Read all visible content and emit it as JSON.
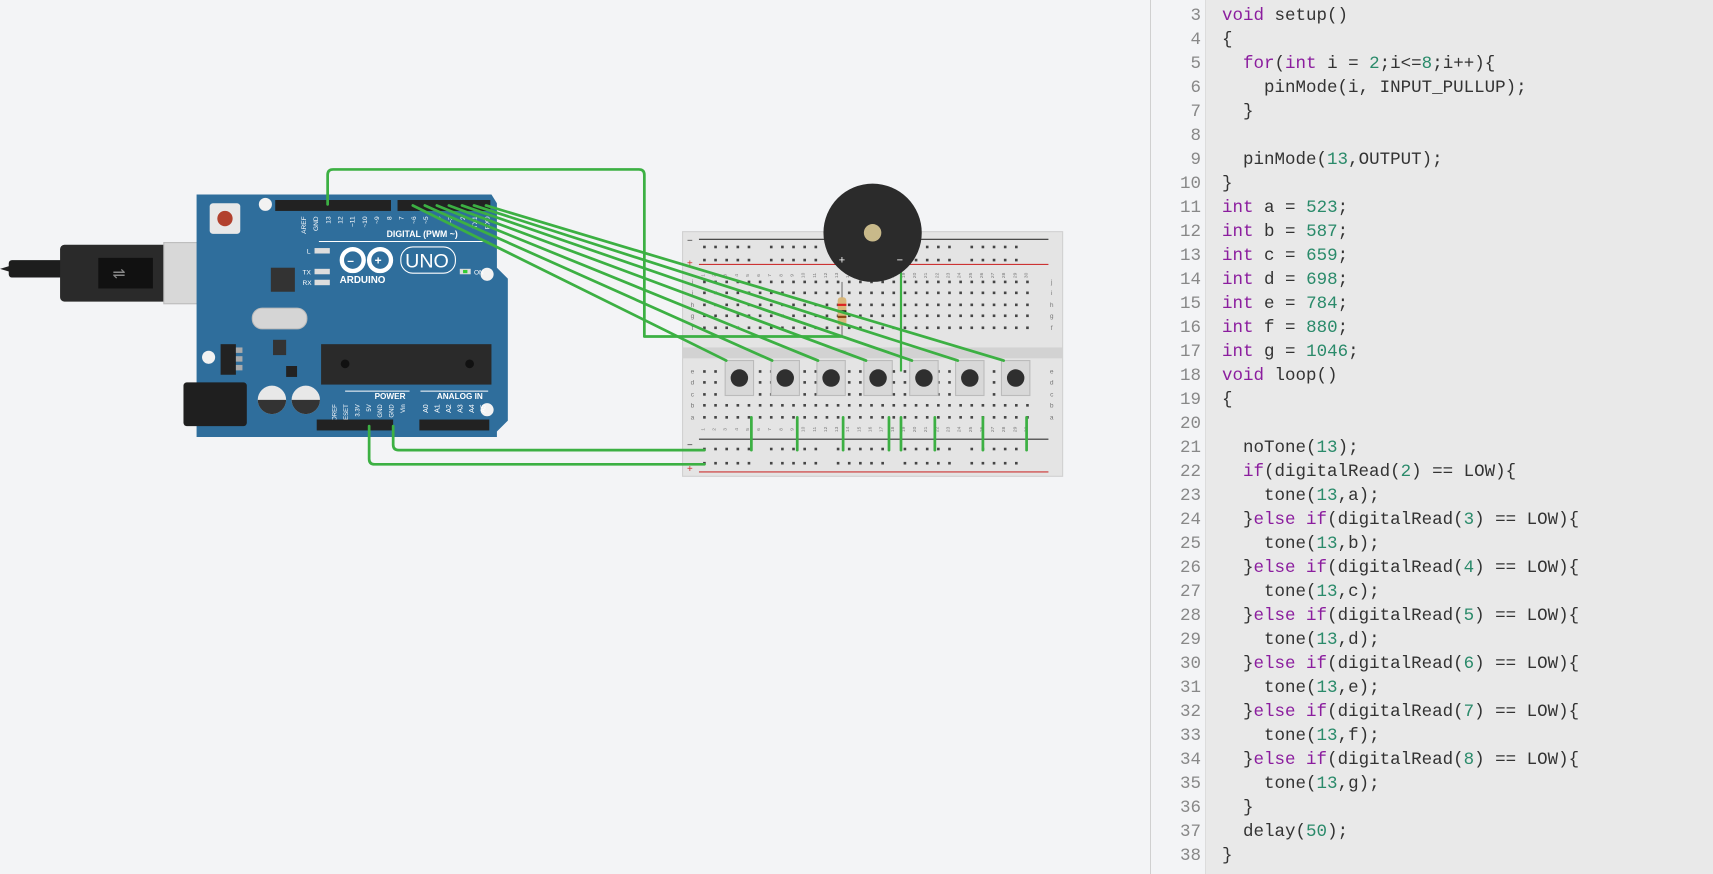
{
  "circuit": {
    "arduino": {
      "brand": "ARDUINO",
      "model": "UNO",
      "digital_label": "DIGITAL (PWM ~)",
      "power_label": "POWER",
      "analog_label": "ANALOG IN",
      "on_label": "ON",
      "led_labels": [
        "L",
        "TX",
        "RX"
      ],
      "digital_pins": [
        "AREF",
        "GND",
        "13",
        "12",
        "~11",
        "~10",
        "~9",
        "8",
        "7",
        "~6",
        "~5",
        "4",
        "~3",
        "2",
        "TX1",
        "RX0"
      ],
      "power_pins": [
        "IOREF",
        "RESET",
        "3.3V",
        "5V",
        "GND",
        "GND",
        "Vin"
      ],
      "analog_pins": [
        "A0",
        "A1",
        "A2",
        "A3",
        "A4",
        "A5"
      ],
      "board_color": "#2f6e9c"
    },
    "wire_color": "#3cb043",
    "buttons_count": 7,
    "breadboard_columns": 30,
    "breadboard_rows_top": [
      "j",
      "i",
      "h",
      "g",
      "f"
    ],
    "breadboard_rows_bottom": [
      "e",
      "d",
      "c",
      "b",
      "a"
    ],
    "rail_minus": "−",
    "rail_plus": "+"
  },
  "code": {
    "lines": [
      {
        "n": "3",
        "text": "void setup()"
      },
      {
        "n": "4",
        "text": "{"
      },
      {
        "n": "5",
        "text": "  for(int i = 2;i<=8;i++){"
      },
      {
        "n": "6",
        "text": "    pinMode(i, INPUT_PULLUP);"
      },
      {
        "n": "7",
        "text": "  }"
      },
      {
        "n": "8",
        "text": ""
      },
      {
        "n": "9",
        "text": "  pinMode(13,OUTPUT);"
      },
      {
        "n": "10",
        "text": "}"
      },
      {
        "n": "11",
        "text": "int a = 523;"
      },
      {
        "n": "12",
        "text": "int b = 587;"
      },
      {
        "n": "13",
        "text": "int c = 659;"
      },
      {
        "n": "14",
        "text": "int d = 698;"
      },
      {
        "n": "15",
        "text": "int e = 784;"
      },
      {
        "n": "16",
        "text": "int f = 880;"
      },
      {
        "n": "17",
        "text": "int g = 1046;"
      },
      {
        "n": "18",
        "text": "void loop()"
      },
      {
        "n": "19",
        "text": "{"
      },
      {
        "n": "20",
        "text": ""
      },
      {
        "n": "21",
        "text": "  noTone(13);"
      },
      {
        "n": "22",
        "text": "  if(digitalRead(2) == LOW){"
      },
      {
        "n": "23",
        "text": "    tone(13,a);"
      },
      {
        "n": "24",
        "text": "  }else if(digitalRead(3) == LOW){"
      },
      {
        "n": "25",
        "text": "    tone(13,b);"
      },
      {
        "n": "26",
        "text": "  }else if(digitalRead(4) == LOW){"
      },
      {
        "n": "27",
        "text": "    tone(13,c);"
      },
      {
        "n": "28",
        "text": "  }else if(digitalRead(5) == LOW){"
      },
      {
        "n": "29",
        "text": "    tone(13,d);"
      },
      {
        "n": "30",
        "text": "  }else if(digitalRead(6) == LOW){"
      },
      {
        "n": "31",
        "text": "    tone(13,e);"
      },
      {
        "n": "32",
        "text": "  }else if(digitalRead(7) == LOW){"
      },
      {
        "n": "33",
        "text": "    tone(13,f);"
      },
      {
        "n": "34",
        "text": "  }else if(digitalRead(8) == LOW){"
      },
      {
        "n": "35",
        "text": "    tone(13,g);"
      },
      {
        "n": "36",
        "text": "  }"
      },
      {
        "n": "37",
        "text": "  delay(50);"
      },
      {
        "n": "38",
        "text": "}"
      }
    ],
    "keyword_color": "#8b1d9e",
    "number_color": "#2a8a6a"
  }
}
